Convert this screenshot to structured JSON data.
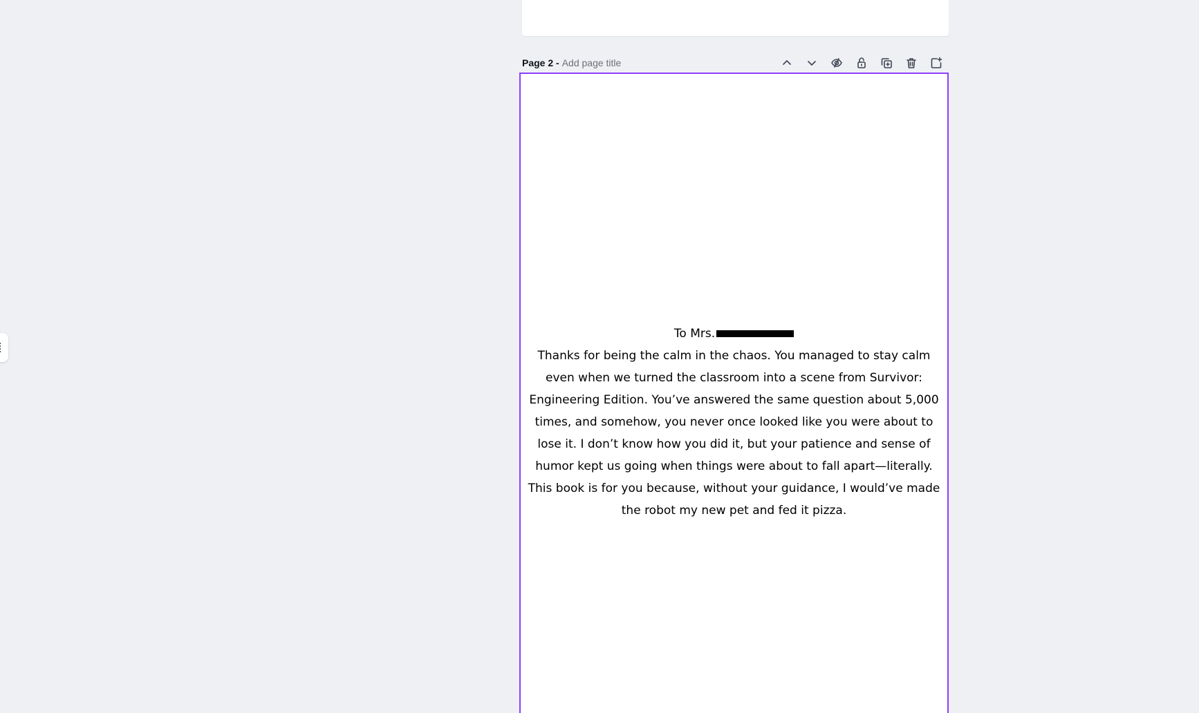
{
  "previous_page": {},
  "page": {
    "label": "Page 2 -",
    "title_placeholder": "Add page title"
  },
  "toolbar": {
    "icons": [
      "chevron-up-icon",
      "chevron-down-icon",
      "hide-icon",
      "lock-icon",
      "duplicate-icon",
      "trash-icon",
      "add-page-icon"
    ]
  },
  "content": {
    "to_line": "To Mrs.",
    "body": "Thanks for being the calm in the chaos. You managed to stay calm even when we turned the classroom into a scene from Survivor: Engineering Edition. You’ve answered the same question about 5,000 times, and somehow, you never once looked like you were about to lose it. I don’t know how you did it, but your patience and sense of humor kept us going when things were about to fall apart—literally.  This book is for you because, without your guidance, I would’ve made the robot my new pet and fed it pizza."
  },
  "colors": {
    "selection_border": "#8b3dff",
    "background": "#eff0f4",
    "page": "#ffffff"
  }
}
